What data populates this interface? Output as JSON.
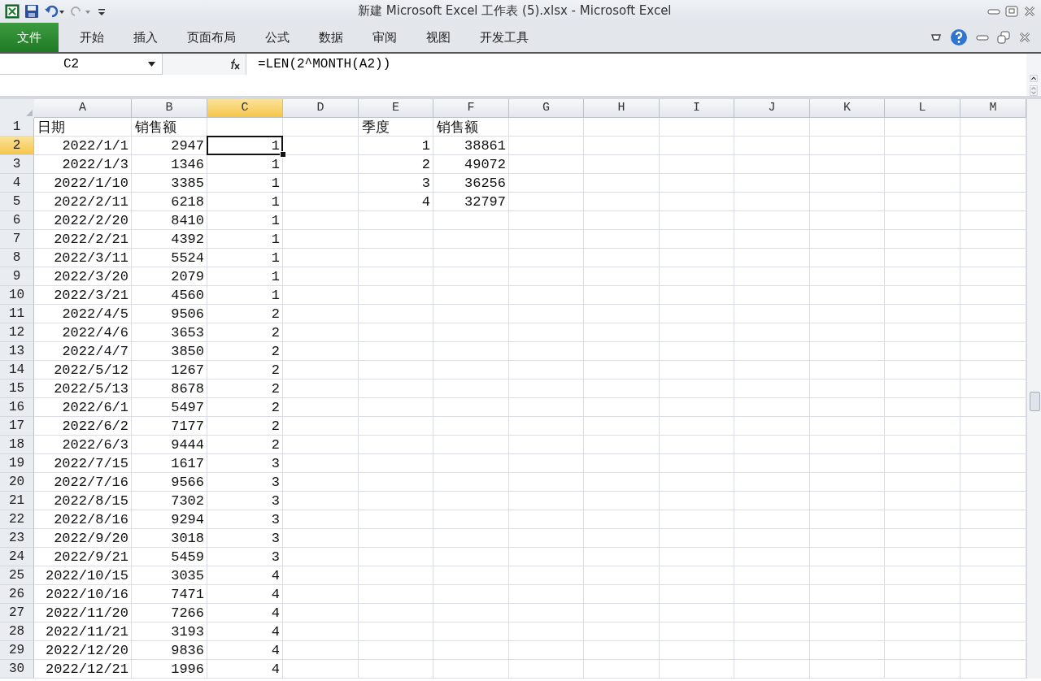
{
  "window": {
    "title": "新建 Microsoft Excel 工作表 (5).xlsx - Microsoft Excel"
  },
  "ribbon_tabs": [
    {
      "label": "文件",
      "kind": "file"
    },
    {
      "label": "开始",
      "kind": "tab"
    },
    {
      "label": "插入",
      "kind": "tab"
    },
    {
      "label": "页面布局",
      "kind": "tab"
    },
    {
      "label": "公式",
      "kind": "tab"
    },
    {
      "label": "数据",
      "kind": "tab"
    },
    {
      "label": "审阅",
      "kind": "tab"
    },
    {
      "label": "视图",
      "kind": "tab"
    },
    {
      "label": "开发工具",
      "kind": "tab"
    }
  ],
  "formula_bar": {
    "name_box": "C2",
    "formula": "=LEN(2^MONTH(A2))"
  },
  "columns": [
    {
      "label": "A",
      "selected": false
    },
    {
      "label": "B",
      "selected": false
    },
    {
      "label": "C",
      "selected": true
    },
    {
      "label": "D",
      "selected": false
    },
    {
      "label": "E",
      "selected": false
    },
    {
      "label": "F",
      "selected": false
    },
    {
      "label": "G",
      "selected": false
    },
    {
      "label": "H",
      "selected": false
    },
    {
      "label": "I",
      "selected": false
    },
    {
      "label": "J",
      "selected": false
    },
    {
      "label": "K",
      "selected": false
    },
    {
      "label": "L",
      "selected": false
    },
    {
      "label": "M",
      "selected": false
    }
  ],
  "rows": [
    {
      "number": "1",
      "selected": false,
      "kind": "header",
      "cells": {
        "A": "日期",
        "B": "销售额",
        "E": "季度",
        "F": "销售额"
      }
    },
    {
      "number": "2",
      "selected": true,
      "kind": "data",
      "cells": {
        "A": "2022/1/1",
        "B": "2947",
        "C": "1",
        "E": "1",
        "F": "38861"
      }
    },
    {
      "number": "3",
      "selected": false,
      "kind": "data",
      "cells": {
        "A": "2022/1/3",
        "B": "1346",
        "C": "1",
        "E": "2",
        "F": "49072"
      }
    },
    {
      "number": "4",
      "selected": false,
      "kind": "data",
      "cells": {
        "A": "2022/1/10",
        "B": "3385",
        "C": "1",
        "E": "3",
        "F": "36256"
      }
    },
    {
      "number": "5",
      "selected": false,
      "kind": "data",
      "cells": {
        "A": "2022/2/11",
        "B": "6218",
        "C": "1",
        "E": "4",
        "F": "32797"
      }
    },
    {
      "number": "6",
      "selected": false,
      "kind": "data",
      "cells": {
        "A": "2022/2/20",
        "B": "8410",
        "C": "1"
      }
    },
    {
      "number": "7",
      "selected": false,
      "kind": "data",
      "cells": {
        "A": "2022/2/21",
        "B": "4392",
        "C": "1"
      }
    },
    {
      "number": "8",
      "selected": false,
      "kind": "data",
      "cells": {
        "A": "2022/3/11",
        "B": "5524",
        "C": "1"
      }
    },
    {
      "number": "9",
      "selected": false,
      "kind": "data",
      "cells": {
        "A": "2022/3/20",
        "B": "2079",
        "C": "1"
      }
    },
    {
      "number": "10",
      "selected": false,
      "kind": "data",
      "cells": {
        "A": "2022/3/21",
        "B": "4560",
        "C": "1"
      }
    },
    {
      "number": "11",
      "selected": false,
      "kind": "data",
      "cells": {
        "A": "2022/4/5",
        "B": "9506",
        "C": "2"
      }
    },
    {
      "number": "12",
      "selected": false,
      "kind": "data",
      "cells": {
        "A": "2022/4/6",
        "B": "3653",
        "C": "2"
      }
    },
    {
      "number": "13",
      "selected": false,
      "kind": "data",
      "cells": {
        "A": "2022/4/7",
        "B": "3850",
        "C": "2"
      }
    },
    {
      "number": "14",
      "selected": false,
      "kind": "data",
      "cells": {
        "A": "2022/5/12",
        "B": "1267",
        "C": "2"
      }
    },
    {
      "number": "15",
      "selected": false,
      "kind": "data",
      "cells": {
        "A": "2022/5/13",
        "B": "8678",
        "C": "2"
      }
    },
    {
      "number": "16",
      "selected": false,
      "kind": "data",
      "cells": {
        "A": "2022/6/1",
        "B": "5497",
        "C": "2"
      }
    },
    {
      "number": "17",
      "selected": false,
      "kind": "data",
      "cells": {
        "A": "2022/6/2",
        "B": "7177",
        "C": "2"
      }
    },
    {
      "number": "18",
      "selected": false,
      "kind": "data",
      "cells": {
        "A": "2022/6/3",
        "B": "9444",
        "C": "2"
      }
    },
    {
      "number": "19",
      "selected": false,
      "kind": "data",
      "cells": {
        "A": "2022/7/15",
        "B": "1617",
        "C": "3"
      }
    },
    {
      "number": "20",
      "selected": false,
      "kind": "data",
      "cells": {
        "A": "2022/7/16",
        "B": "9566",
        "C": "3"
      }
    },
    {
      "number": "21",
      "selected": false,
      "kind": "data",
      "cells": {
        "A": "2022/8/15",
        "B": "7302",
        "C": "3"
      }
    },
    {
      "number": "22",
      "selected": false,
      "kind": "data",
      "cells": {
        "A": "2022/8/16",
        "B": "9294",
        "C": "3"
      }
    },
    {
      "number": "23",
      "selected": false,
      "kind": "data",
      "cells": {
        "A": "2022/9/20",
        "B": "3018",
        "C": "3"
      }
    },
    {
      "number": "24",
      "selected": false,
      "kind": "data",
      "cells": {
        "A": "2022/9/21",
        "B": "5459",
        "C": "3"
      }
    },
    {
      "number": "25",
      "selected": false,
      "kind": "data",
      "cells": {
        "A": "2022/10/15",
        "B": "3035",
        "C": "4"
      }
    },
    {
      "number": "26",
      "selected": false,
      "kind": "data",
      "cells": {
        "A": "2022/10/16",
        "B": "7471",
        "C": "4"
      }
    },
    {
      "number": "27",
      "selected": false,
      "kind": "data",
      "cells": {
        "A": "2022/11/20",
        "B": "7266",
        "C": "4"
      }
    },
    {
      "number": "28",
      "selected": false,
      "kind": "data",
      "cells": {
        "A": "2022/11/21",
        "B": "3193",
        "C": "4"
      }
    },
    {
      "number": "29",
      "selected": false,
      "kind": "data",
      "cells": {
        "A": "2022/12/20",
        "B": "9836",
        "C": "4"
      }
    },
    {
      "number": "30",
      "selected": false,
      "kind": "data",
      "cells": {
        "A": "2022/12/21",
        "B": "1996",
        "C": "4"
      }
    }
  ]
}
